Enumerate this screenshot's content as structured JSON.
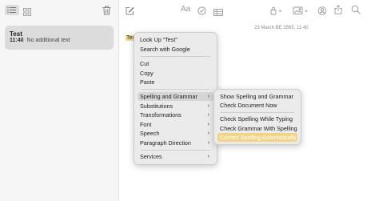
{
  "sidebar": {
    "toolbar": {
      "list_icon": "list-view-icon",
      "grid_icon": "gallery-view-icon",
      "trash_icon": "trash-icon"
    },
    "note": {
      "title": "Test",
      "time": "11:40",
      "preview": "No additional text"
    }
  },
  "editor": {
    "toolbar": {
      "compose_icon": "compose-icon",
      "format_icon": "text-format-icon",
      "format_label": "Aa",
      "checklist_icon": "checklist-icon",
      "table_icon": "table-icon",
      "lock_icon": "lock-icon",
      "media_icon": "media-icon",
      "collaborate_icon": "collaborate-icon",
      "share_icon": "share-icon",
      "search_icon": "search-icon"
    },
    "date": "23 March BE 2565, 11:40",
    "body_text": "Tes"
  },
  "context_menu": {
    "items": [
      {
        "label": "Look Up “Test”"
      },
      {
        "label": "Search with Google"
      },
      {
        "label": "Cut"
      },
      {
        "label": "Copy"
      },
      {
        "label": "Paste"
      },
      {
        "label": "Spelling and Grammar",
        "submenu": true
      },
      {
        "label": "Substitutions",
        "submenu": true
      },
      {
        "label": "Transformations",
        "submenu": true
      },
      {
        "label": "Font",
        "submenu": true
      },
      {
        "label": "Speech",
        "submenu": true
      },
      {
        "label": "Paragraph Direction",
        "submenu": true
      },
      {
        "label": "Services",
        "submenu": true
      }
    ]
  },
  "submenu": {
    "items": [
      {
        "label": "Show Spelling and Grammar"
      },
      {
        "label": "Check Document Now"
      },
      {
        "label": "Check Spelling While Typing"
      },
      {
        "label": "Check Grammar With Spelling"
      },
      {
        "label": "Correct Spelling Automatically"
      }
    ]
  },
  "colors": {
    "selection": "#f2d488",
    "hover": "#d6d6d6"
  }
}
